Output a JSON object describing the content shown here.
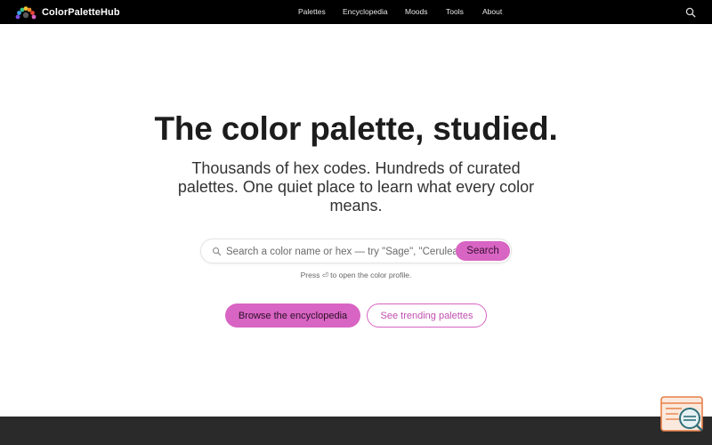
{
  "header": {
    "brand": "ColorPaletteHub",
    "nav": [
      "Palettes",
      "Encyclopedia",
      "Moods",
      "Tools",
      "About"
    ]
  },
  "hero": {
    "title": "The color palette, studied.",
    "subtitle": "Thousands of hex codes. Hundreds of curated palettes. One quiet place to learn what every color means."
  },
  "search": {
    "placeholder": "Search a color name or hex — try \"Sage\", \"Cerulea",
    "button": "Search",
    "hint": "Press ⏎ to open the color profile."
  },
  "cta": {
    "primary": "Browse the encyclopedia",
    "secondary": "See trending palettes"
  },
  "colors": {
    "accent": "#d864c3",
    "topbar": "#000000",
    "footer": "#2a2a2a",
    "widget_orange": "#e8804a",
    "widget_teal": "#2f6f7a"
  },
  "icons": {
    "brand": "palette-fan-icon",
    "search": "search-icon",
    "widget": "developer-tools-icon"
  }
}
